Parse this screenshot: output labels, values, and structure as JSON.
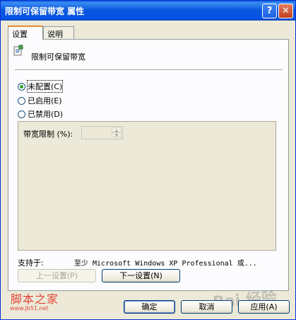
{
  "window": {
    "title": "限制可保留带宽 属性",
    "help_glyph": "?",
    "close_glyph": "✕"
  },
  "tabs": [
    {
      "label": "设置",
      "active": true
    },
    {
      "label": "说明",
      "active": false
    }
  ],
  "policy": {
    "name": "限制可保留带宽",
    "icon": "policy-setting-icon"
  },
  "options": [
    {
      "label": "未配置(C)",
      "checked": true
    },
    {
      "label": "已启用(E)",
      "checked": false
    },
    {
      "label": "已禁用(D)",
      "checked": false
    }
  ],
  "bandwidth": {
    "label": "带宽限制 (%):",
    "value": ""
  },
  "support": {
    "label": "支持于:",
    "text": "至少 Microsoft Windows XP Professional 或..."
  },
  "nav": {
    "prev_label": "上一设置(P)",
    "next_label": "下一设置(N)"
  },
  "footer": {
    "ok_label": "确定",
    "cancel_label": "取消",
    "apply_label": "应用(A)"
  },
  "watermark": {
    "site_cn": "脚本之家",
    "site_url": "www.jb51.net",
    "baidu": "Bai 经验"
  },
  "colors": {
    "titlebar": "#0855dd",
    "dialog_bg": "#ece9d8",
    "radio_checked": "#2fa32f",
    "tab_highlight": "#e68b2c"
  }
}
